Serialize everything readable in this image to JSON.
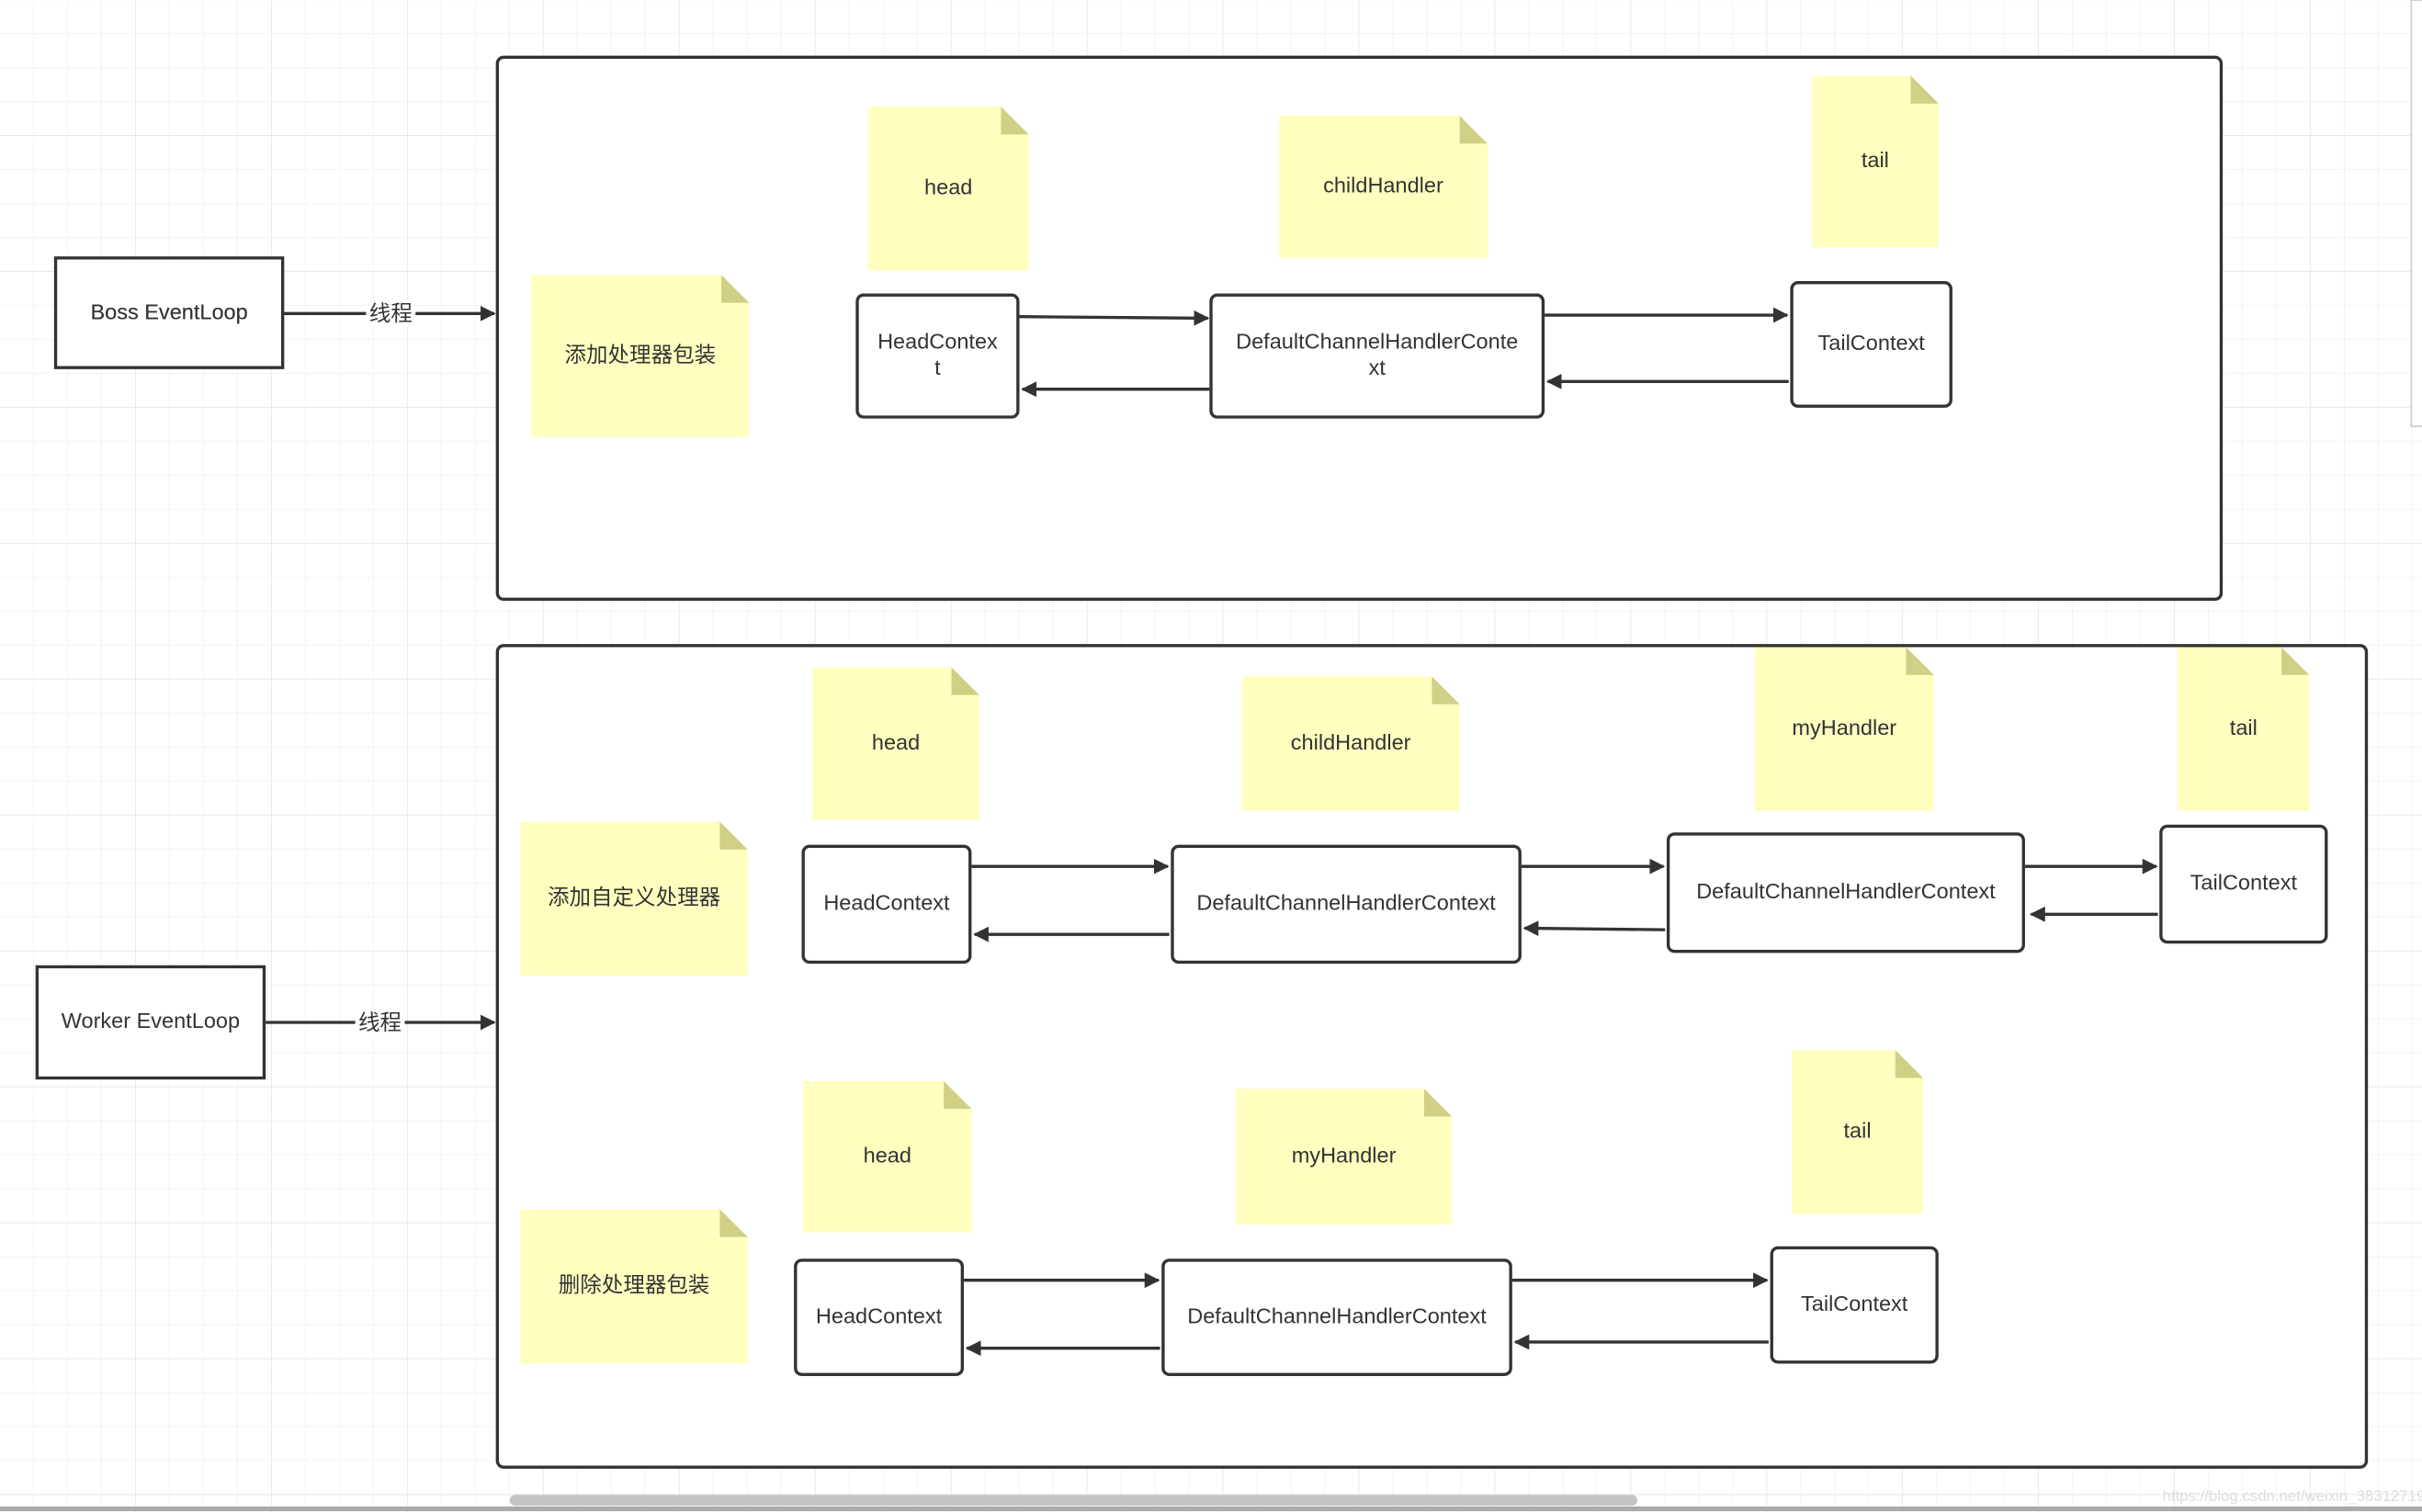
{
  "colors": {
    "note_fill": "#ffffc0",
    "note_fold": "#cfcf86",
    "stroke": "#333333",
    "grid": "#eeeeee"
  },
  "boss": {
    "label": "Boss  EventLoop",
    "edge_label": "线程"
  },
  "worker": {
    "label": "Worker  EventLoop",
    "edge_label": "线程"
  },
  "boss_group": {
    "note": "添加处理器包装",
    "tags": [
      "head",
      "childHandler",
      "tail"
    ],
    "nodes": [
      [
        "HeadContex",
        "t"
      ],
      [
        "DefaultChannelHandlerConte",
        "xt"
      ],
      [
        "TailContext"
      ]
    ]
  },
  "worker_add": {
    "note": "添加自定义处理器",
    "tags": [
      "head",
      "childHandler",
      "myHandler",
      "tail"
    ],
    "nodes": [
      [
        "HeadContext"
      ],
      [
        "DefaultChannelHandlerContext"
      ],
      [
        "DefaultChannelHandlerContext"
      ],
      [
        "TailContext"
      ]
    ]
  },
  "worker_remove": {
    "note": "删除处理器包装",
    "tags": [
      "head",
      "myHandler",
      "tail"
    ],
    "nodes": [
      [
        "HeadContext"
      ],
      [
        "DefaultChannelHandlerContext"
      ],
      [
        "TailContext"
      ]
    ]
  },
  "watermark": "https://blog.csdn.net/weixin_38312719"
}
